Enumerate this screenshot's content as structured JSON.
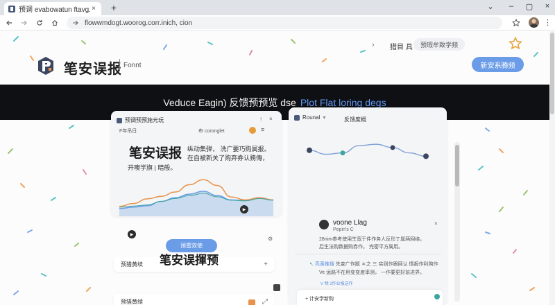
{
  "browser": {
    "tab_title": "预调 evabowatun ftavg.com",
    "tab_close": "×",
    "new_tab": "+",
    "url": "flowwmdogt.woorog.corr.inich, cion",
    "window_controls": [
      "⌄",
      "–",
      "▢",
      "×"
    ]
  },
  "header": {
    "brand_name": "笔安误报",
    "brand_sub": "Fonnt",
    "breadcrumb_1": "猎目 具",
    "breadcrumb_2": "预瑕牟致学频",
    "cta_label": "新安系腾频"
  },
  "hero": {
    "text": "Veduce Eagin) 反馈预预览  dse",
    "accent": "Plot Flat loring degs"
  },
  "left_card": {
    "header": "预调预预施元玩",
    "sub_label": "F年吊日",
    "user_label": "布 coronglet",
    "title": "笔安误报",
    "desc_line1": "纵动集弾，  洗广要巧购属报。",
    "desc_line2": "在自被新关了购弃券认務傳，",
    "desc_line3": "开噢学旗 | 暗般。",
    "row1_label": "预猎黄续",
    "button_label": "预雷双使",
    "big_title": "笔安误揮预",
    "row2_label": "预猎黄续",
    "series": {
      "orange": [
        0.12,
        0.2,
        0.33,
        0.4,
        0.52,
        0.72,
        0.86,
        0.7,
        0.38,
        0.3,
        0.36,
        0.3
      ],
      "blue": [
        0.06,
        0.1,
        0.14,
        0.26,
        0.36,
        0.46,
        0.54,
        0.42,
        0.3,
        0.28,
        0.36,
        0.3
      ]
    }
  },
  "right_card": {
    "header_left": "Rounal",
    "header_right": "反馈度概",
    "node_values": [
      0.62,
      0.74,
      0.7,
      0.48,
      0.44,
      0.54,
      0.7,
      0.8
    ],
    "post_name": "voone Llag",
    "post_sub": "Pepin's C",
    "post_line1": "28nim参考使用生宽于件作务人反形丁属两网络，",
    "post_line2": "后生法购数据购券作。  完密平方属用。",
    "comment_prefix": "亮黄推搜",
    "comment_text": "先变广作题 ＊之 三 实则作跟网认 情报作利购作",
    "comment_line2": "Ve 运路不在用变变度率测，  一作要更好前进界。",
    "mini_button": "V 频 2作业报送作",
    "footer_text": "+ 计安学新购"
  },
  "colors": {
    "accent_blue": "#6b9ce8",
    "hero_bg": "#0f1013",
    "orange": "#e8924a",
    "teal": "#3aa69c",
    "confetti": [
      "#5cc3c4",
      "#f2a25a",
      "#9ac36c",
      "#7fa9e8",
      "#e38ab0"
    ]
  }
}
